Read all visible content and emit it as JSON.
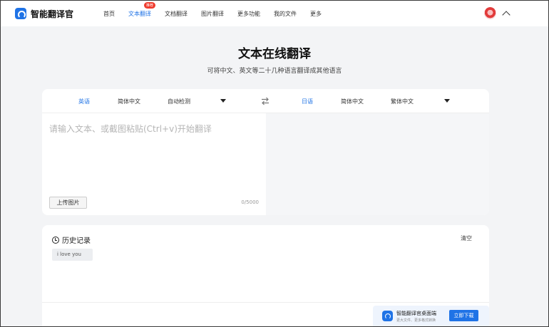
{
  "brand": {
    "name": "智能翻译官",
    "logo_icon": "translator-logo-icon"
  },
  "nav": {
    "items": [
      {
        "label": "首页",
        "active": false
      },
      {
        "label": "文本翻译",
        "active": true,
        "badge": "推荐"
      },
      {
        "label": "文档翻译",
        "active": false
      },
      {
        "label": "图片翻译",
        "active": false
      },
      {
        "label": "更多功能",
        "active": false
      },
      {
        "label": "我的文件",
        "active": false
      },
      {
        "label": "更多",
        "active": false
      }
    ]
  },
  "user": {
    "avatar_icon": "user-avatar-icon",
    "collapse_icon": "chevron-up-icon"
  },
  "page": {
    "title": "文本在线翻译",
    "subtitle": "可将中文、英文等二十几种语言翻译成其他语言"
  },
  "translator": {
    "source_langs": [
      "英语",
      "简体中文",
      "自动检测"
    ],
    "target_langs": [
      "日语",
      "简体中文",
      "繁体中文"
    ],
    "swap_icon": "swap-arrows-icon",
    "input": {
      "placeholder": "请输入文本、或截图粘贴(Ctrl+v)开始翻译",
      "value": ""
    },
    "upload_label": "上传图片",
    "char_count": "0/5000"
  },
  "history": {
    "title": "历史记录",
    "icon": "history-clock-icon",
    "clear_label": "清空",
    "items": [
      "i love you"
    ]
  },
  "promo": {
    "title": "智能翻译官桌面端",
    "subtitle": "更大文件、更多格式转换",
    "button_label": "立即下载"
  },
  "colors": {
    "accent": "#1f73e6",
    "badge": "#ef3b2d",
    "page_bg": "#f3f4f6"
  }
}
